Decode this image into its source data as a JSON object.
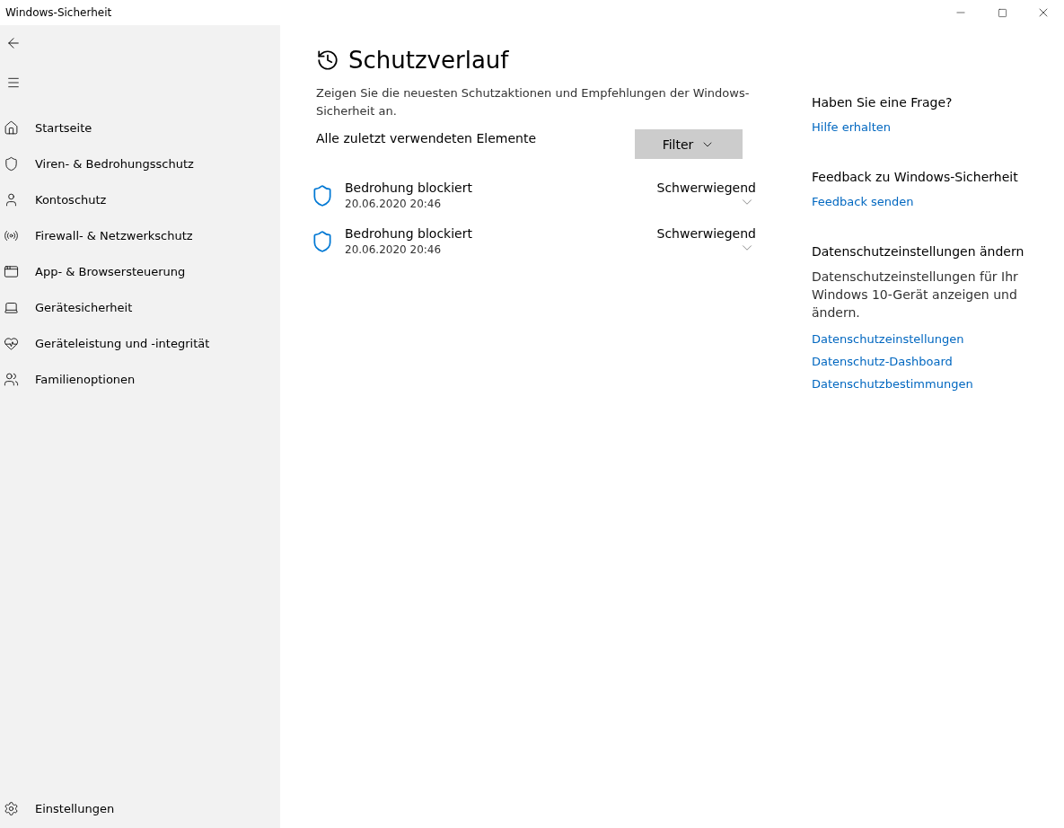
{
  "window": {
    "title": "Windows-Sicherheit"
  },
  "sidebar": {
    "items": [
      {
        "label": "Startseite"
      },
      {
        "label": "Viren- & Bedrohungsschutz"
      },
      {
        "label": "Kontoschutz"
      },
      {
        "label": "Firewall- & Netzwerkschutz"
      },
      {
        "label": "App- & Browsersteuerung"
      },
      {
        "label": "Gerätesicherheit"
      },
      {
        "label": "Geräteleistung und -integrität"
      },
      {
        "label": "Familienoptionen"
      }
    ],
    "settings": "Einstellungen"
  },
  "main": {
    "title": "Schutzverlauf",
    "description": "Zeigen Sie die neuesten Schutzaktionen und Empfehlungen der Windows-Sicherheit an.",
    "list_label": "Alle zuletzt verwendeten Elemente",
    "filter": "Filter",
    "entries": [
      {
        "title": "Bedrohung blockiert",
        "time": "20.06.2020 20:46",
        "severity": "Schwerwiegend",
        "expanded": false
      },
      {
        "title": "Bedrohung blockiert",
        "time": "20.06.2020 20:46",
        "severity": "Schwerwiegend",
        "expanded": false
      }
    ]
  },
  "aside": {
    "sections": [
      {
        "heading": "Haben Sie eine Frage?",
        "links": [
          "Hilfe erhalten"
        ]
      },
      {
        "heading": "Feedback zu Windows-Sicherheit",
        "links": [
          "Feedback senden"
        ]
      },
      {
        "heading": "Datenschutzeinstellungen ändern",
        "text": "Datenschutzeinstellungen für Ihr Windows 10-Gerät anzeigen und ändern.",
        "links": [
          "Datenschutzeinstellungen",
          "Datenschutz-Dashboard",
          "Datenschutzbestimmungen"
        ]
      }
    ]
  }
}
